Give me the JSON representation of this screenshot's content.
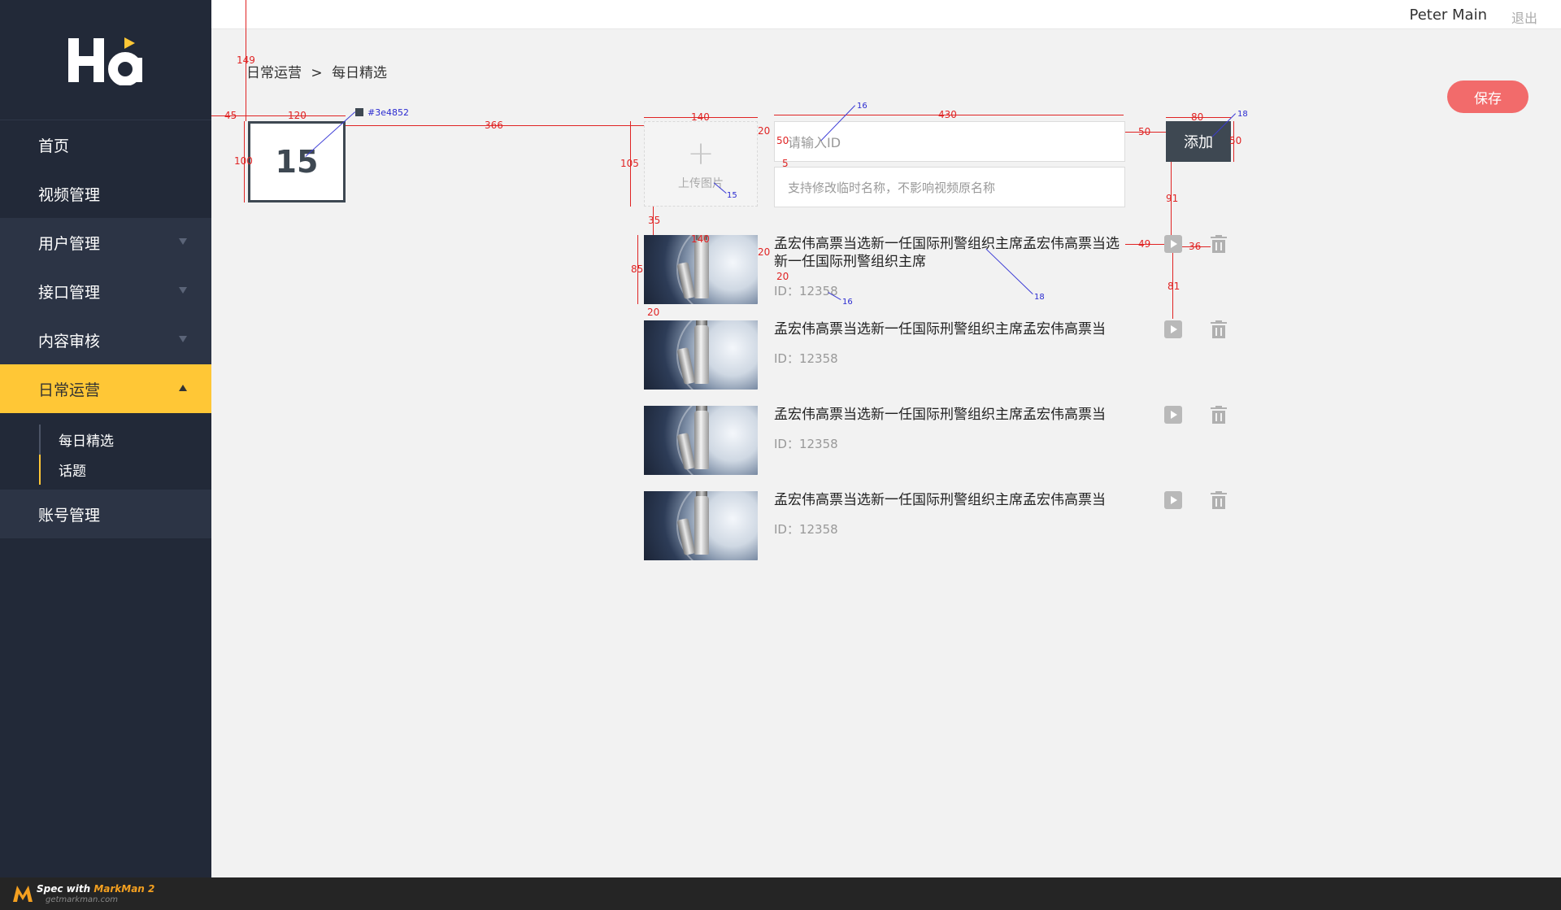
{
  "brand": {
    "logo_text": "Ha"
  },
  "header": {
    "user_name": "Peter Main",
    "logout_label": "退出"
  },
  "sidebar": {
    "items": [
      {
        "label": "首页"
      },
      {
        "label": "视频管理"
      },
      {
        "label": "用户管理"
      },
      {
        "label": "接口管理"
      },
      {
        "label": "内容审核"
      },
      {
        "label": "日常运营"
      },
      {
        "label": "账号管理"
      }
    ],
    "submenu": [
      {
        "label": "每日精选"
      },
      {
        "label": "话题"
      }
    ]
  },
  "breadcrumb": {
    "parent": "日常运营",
    "separator": ">",
    "current": "每日精选"
  },
  "toolbar": {
    "save_label": "保存",
    "add_label": "添加"
  },
  "count": "15",
  "upload": {
    "label": "上传图片"
  },
  "form": {
    "id_placeholder": "请输入ID",
    "name_placeholder": "支持修改临时名称，不影响视频原名称"
  },
  "list": [
    {
      "title": "孟宏伟高票当选新一任国际刑警组织主席孟宏伟高票当选新一任国际刑警组织主席",
      "id_text": "ID：12358"
    },
    {
      "title": "孟宏伟高票当选新一任国际刑警组织主席孟宏伟高票当",
      "id_text": "ID：12358"
    },
    {
      "title": "孟宏伟高票当选新一任国际刑警组织主席孟宏伟高票当",
      "id_text": "ID：12358"
    },
    {
      "title": "孟宏伟高票当选新一任国际刑警组织主席孟宏伟高票当",
      "id_text": "ID：12358"
    }
  ],
  "colors": {
    "sidebar": "#222938",
    "accent": "#ffc736",
    "primary": "#3e4852",
    "save": "#f26b6b"
  },
  "spec": {
    "color_label": "#3e4852",
    "dims": {
      "top_149": "149",
      "left_45": "45",
      "w_120": "120",
      "h_100": "100",
      "gap_366": "366",
      "w_140": "140",
      "gap_20": "20",
      "w_430": "430",
      "gap_50": "50",
      "w_80": "80",
      "h_50a": "50",
      "h_50b": "50",
      "h_5": "5",
      "h_105": "105",
      "v_35": "35",
      "v_91": "91",
      "w_140b": "140",
      "g_20b": "20",
      "h_85": "85",
      "g_20c": "20",
      "g_49": "49",
      "g_36": "36",
      "v_81": "81",
      "v_20d": "20"
    },
    "fonts": {
      "f16a": "16",
      "f18a": "18",
      "f15": "15",
      "f18b": "18",
      "f16b": "16"
    }
  },
  "footer": {
    "brand_prefix": "Spec with ",
    "brand_name": "MarkMan 2",
    "site": "getmarkman.com"
  }
}
